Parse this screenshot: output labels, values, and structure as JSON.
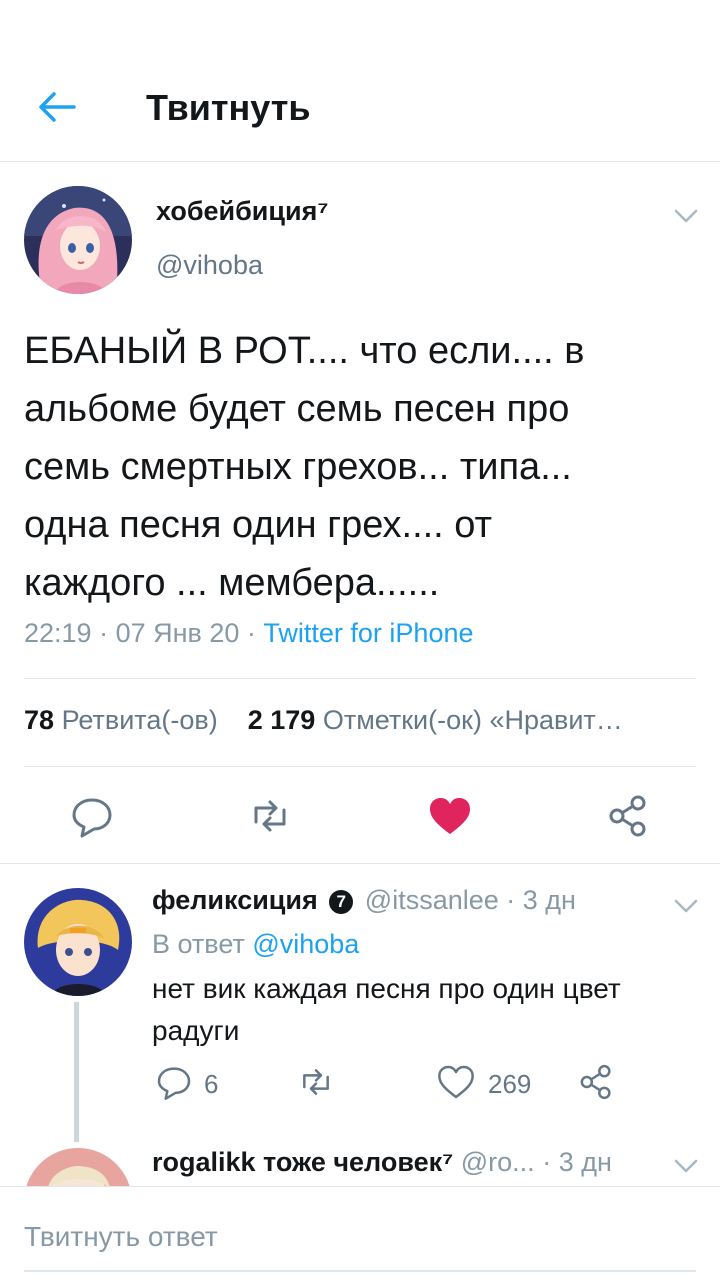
{
  "header": {
    "title": "Твитнуть",
    "back_icon": "arrow-left-icon"
  },
  "tweet": {
    "author_name": "хобейбиция⁷",
    "author_handle": "@vihoba",
    "text": "ЕБАНЫЙ В РОТ.... что если.... в\nальбоме будет семь песен про\nсемь смертных грехов... типа...\nодна песня один грех.... от\nкаждого ... мембера......",
    "time": "22:19",
    "sep": " · ",
    "date": "07 Янв 20",
    "source": "Twitter for iPhone",
    "retweets_count": "78",
    "retweets_label": "Ретвита(-ов)",
    "likes_count": "2 179",
    "likes_label": "Отметки(-ок) «Нравит…",
    "liked": true,
    "colors": {
      "accent": "#1da1f2",
      "like": "#e0245e",
      "muted": "#657786"
    }
  },
  "reply": {
    "author_name": "феликсиция",
    "badge_text": "7",
    "handle": "@itssanlee",
    "sep": " · ",
    "time_ago": "3 дн",
    "reply_prefix": "В ответ",
    "reply_to": "@vihoba",
    "text": "нет вик каждая песня про один цвет радуги",
    "reply_count": "6",
    "like_count": "269"
  },
  "reply2": {
    "author_name": "rogalikk тоже человек⁷",
    "handle": "@ro...",
    "sep": " · ",
    "time_ago": "3 дн"
  },
  "compose": {
    "placeholder": "Твитнуть ответ"
  }
}
